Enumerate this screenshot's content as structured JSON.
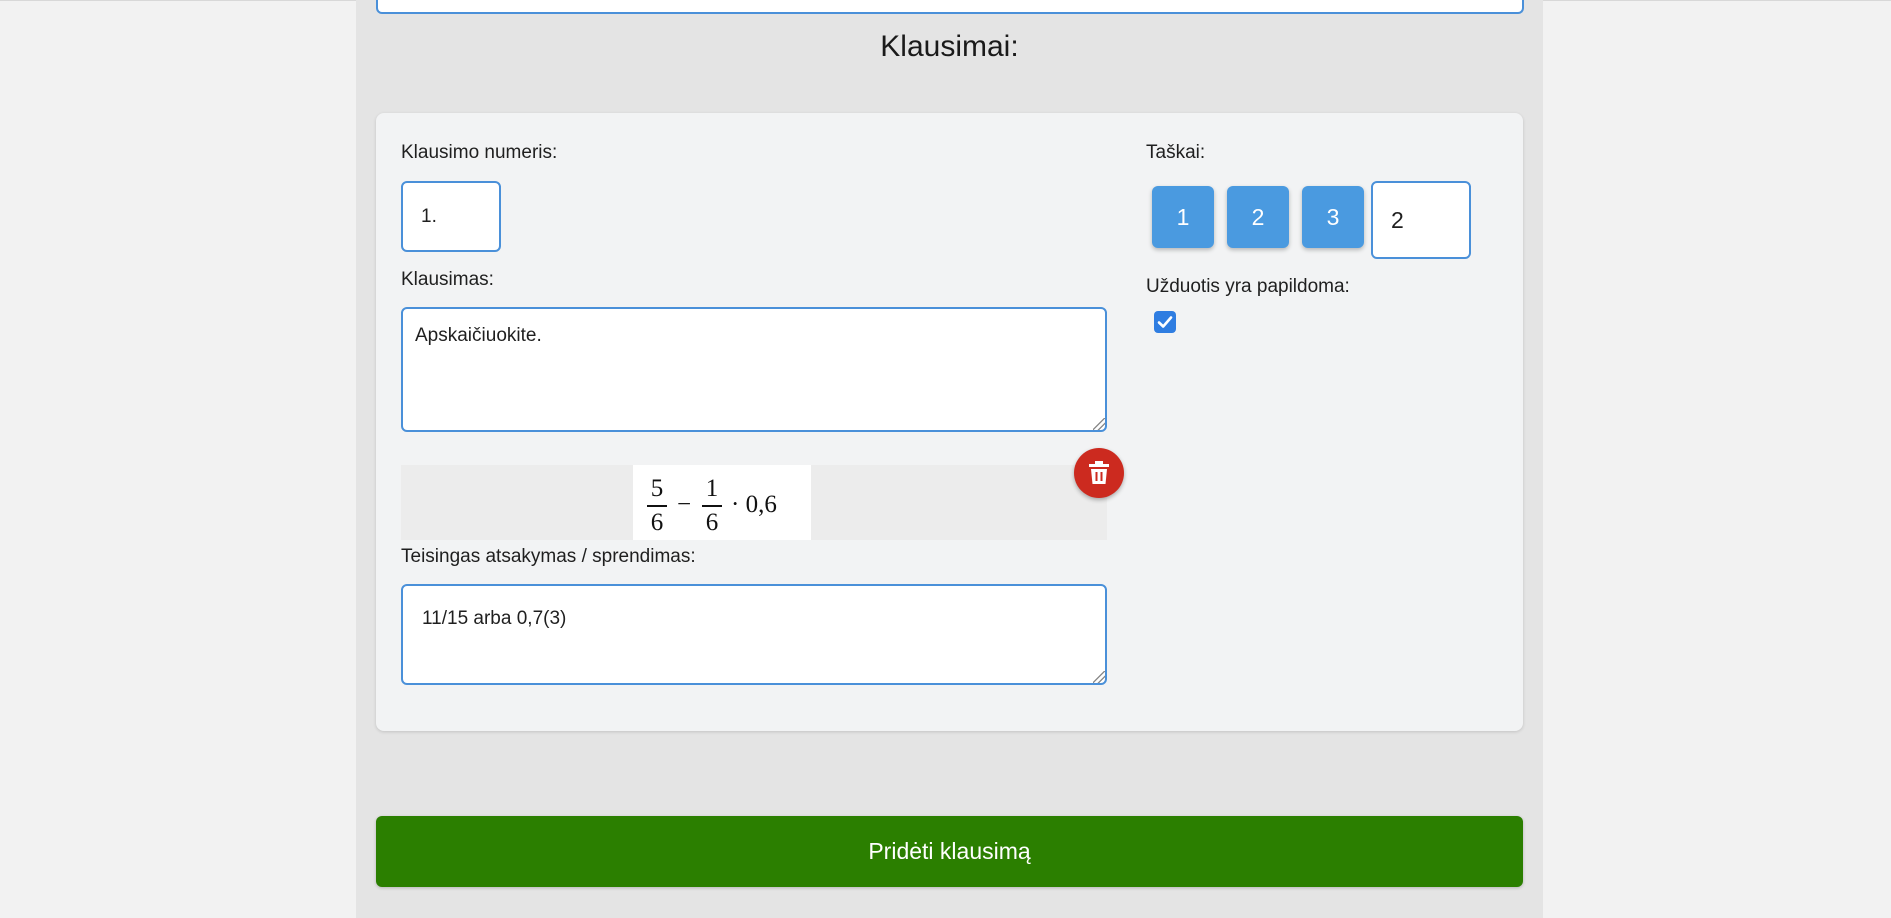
{
  "section": {
    "title": "Klausimai:"
  },
  "question": {
    "number_label": "Klausimo numeris:",
    "number_value": "1.",
    "question_label": "Klausimas:",
    "question_value": "Apskaičiuokite.",
    "answer_label": "Teisingas atsakymas / sprendimas:",
    "answer_value": "11/15 arba 0,7(3)",
    "formula": {
      "frac1_num": "5",
      "frac1_den": "6",
      "minus": "−",
      "frac2_num": "1",
      "frac2_den": "6",
      "tail": "· 0,6"
    },
    "delete_icon": "trash-icon"
  },
  "points": {
    "label": "Taškai:",
    "options": [
      "1",
      "2",
      "3"
    ],
    "value": "2"
  },
  "extra": {
    "label": "Užduotis yra papildoma:",
    "checked": true
  },
  "footer": {
    "add_label": "Pridėti klausimą"
  },
  "colors": {
    "accent": "#4a9ae0",
    "delete": "#cc2a1f",
    "add": "#2b7f00"
  }
}
